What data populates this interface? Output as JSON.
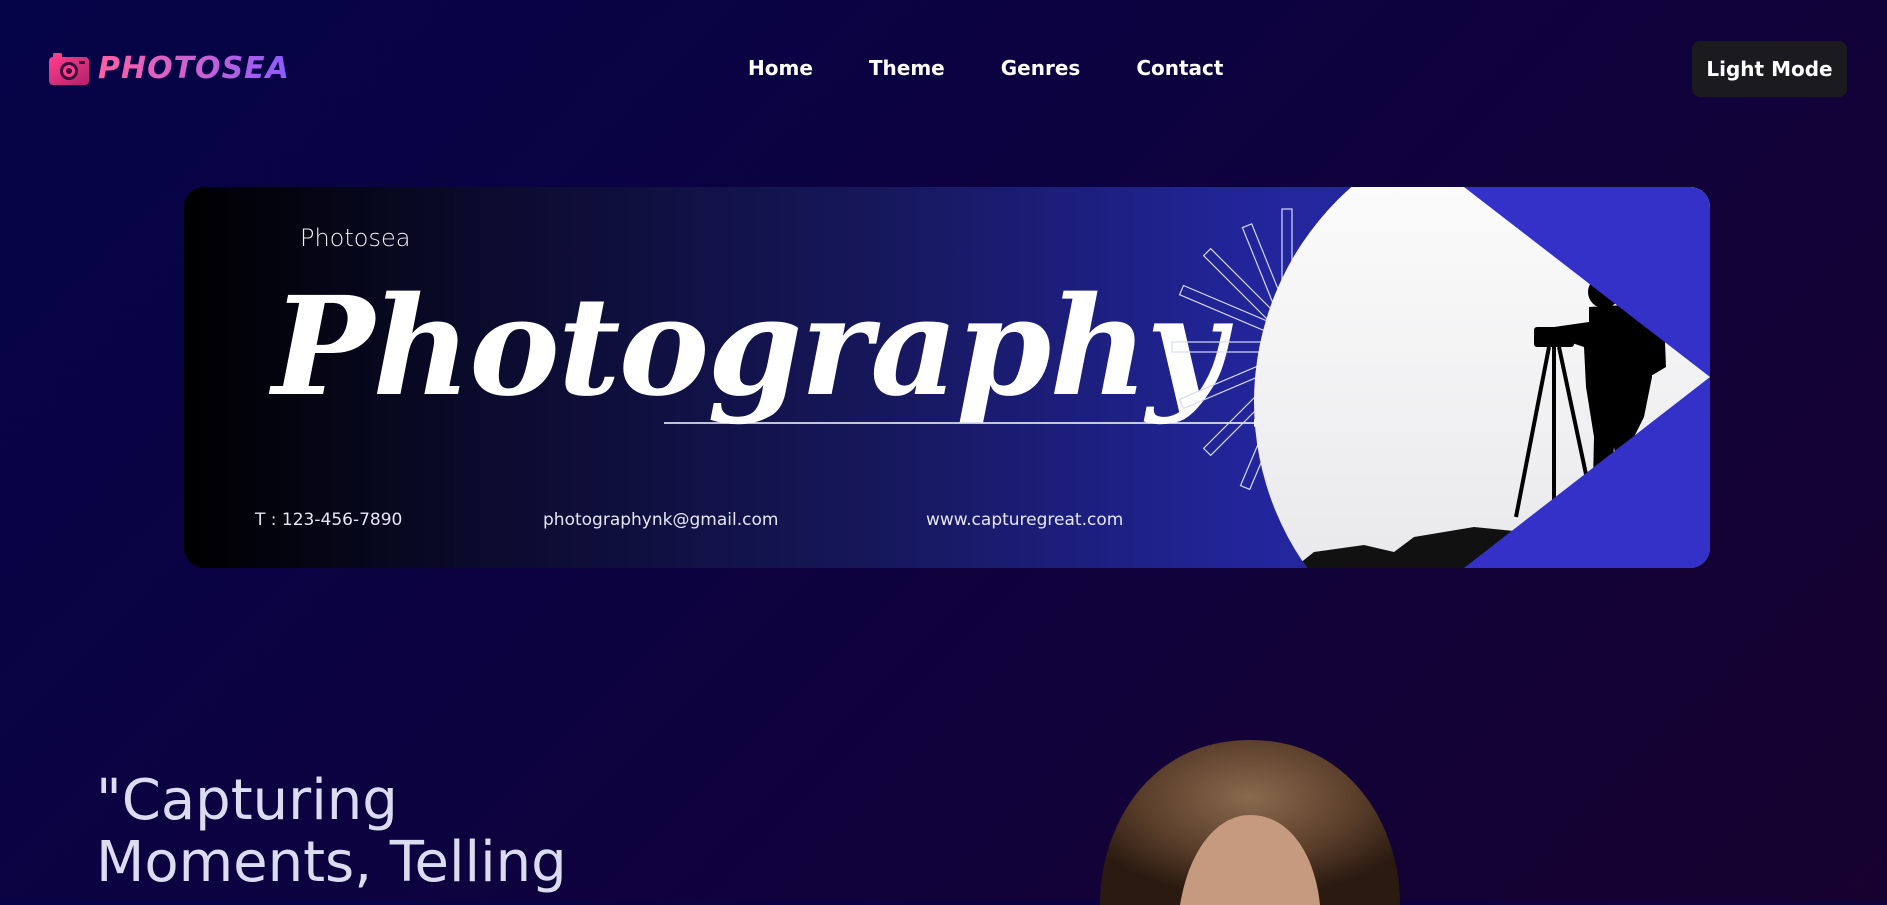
{
  "brand": {
    "name": "PHOTOSEA",
    "icon": "camera-icon"
  },
  "nav": {
    "links": [
      {
        "label": "Home"
      },
      {
        "label": "Theme"
      },
      {
        "label": "Genres"
      },
      {
        "label": "Contact"
      }
    ],
    "mode_button": "Light Mode"
  },
  "banner": {
    "brand": "Photosea",
    "title": "Photography",
    "phone": "T : 123-456-7890",
    "email": "photographynk@gmail.com",
    "website": "www.capturegreat.com"
  },
  "hero": {
    "quote_line1": "\"Capturing",
    "quote_line2": "Moments, Telling"
  },
  "colors": {
    "background_start": "#050448",
    "background_end": "#17022f",
    "logo_gradient_start": "#ff5fa2",
    "logo_gradient_end": "#8a5bff",
    "banner_accent": "#2b2cb4",
    "button_bg": "#1b1b1f"
  }
}
